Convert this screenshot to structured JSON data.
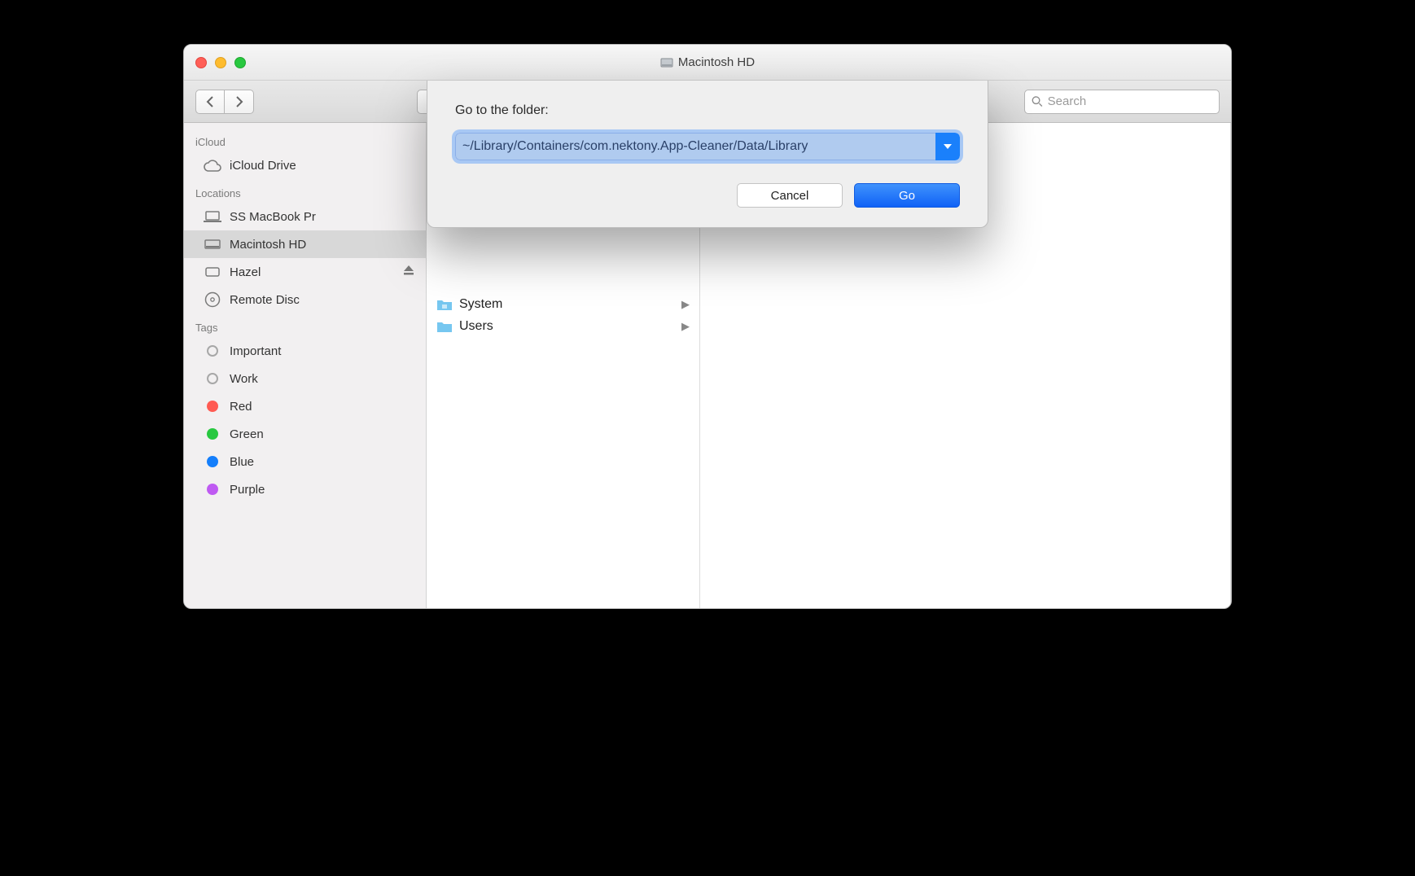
{
  "window": {
    "title": "Macintosh HD"
  },
  "toolbar": {
    "search_placeholder": "Search"
  },
  "sidebar": {
    "sections": [
      {
        "title": "iCloud",
        "items": [
          {
            "label": "iCloud Drive",
            "icon": "cloud"
          }
        ]
      },
      {
        "title": "Locations",
        "items": [
          {
            "label": "SS MacBook Pr",
            "icon": "laptop"
          },
          {
            "label": "Macintosh HD",
            "icon": "hd",
            "selected": true
          },
          {
            "label": "Hazel",
            "icon": "ext",
            "eject": true
          },
          {
            "label": "Remote Disc",
            "icon": "disc"
          }
        ]
      },
      {
        "title": "Tags",
        "items": [
          {
            "label": "Important",
            "icon": "tagdot",
            "color": "none"
          },
          {
            "label": "Work",
            "icon": "tagdot",
            "color": "none"
          },
          {
            "label": "Red",
            "icon": "tagdot",
            "color": "red"
          },
          {
            "label": "Green",
            "icon": "tagdot",
            "color": "green"
          },
          {
            "label": "Blue",
            "icon": "tagdot",
            "color": "blue"
          },
          {
            "label": "Purple",
            "icon": "tagdot",
            "color": "purple"
          }
        ]
      }
    ]
  },
  "files": {
    "left": [
      {
        "name": "System",
        "type": "system-folder"
      },
      {
        "name": "Users",
        "type": "folder"
      }
    ]
  },
  "dialog": {
    "title": "Go to the folder:",
    "path": "~/Library/Containers/com.nektony.App-Cleaner/Data/Library",
    "cancel": "Cancel",
    "go": "Go"
  }
}
